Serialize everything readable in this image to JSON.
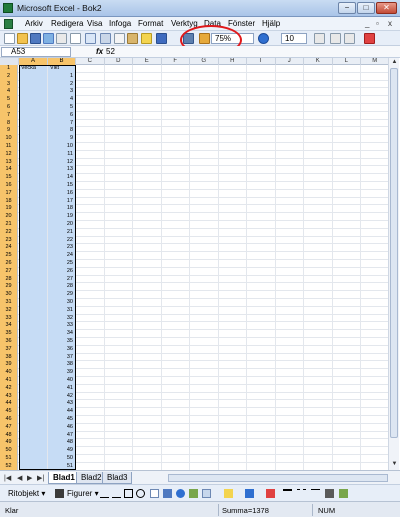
{
  "window": {
    "title": "Microsoft Excel - Bok2",
    "minimize": "−",
    "maximize": "□",
    "close": "✕"
  },
  "menu": {
    "items": [
      "Arkiv",
      "Redigera",
      "Visa",
      "Infoga",
      "Format",
      "Verktyg",
      "Data",
      "Fönster",
      "Hjälp"
    ],
    "doc_min": "_",
    "doc_restore": "▫",
    "doc_close": "x"
  },
  "toolbar": {
    "zoom": "75%",
    "font_size": "10"
  },
  "formula_bar": {
    "name_box": "A53",
    "fx": "fx",
    "value": "52"
  },
  "columns": [
    "A",
    "B",
    "C",
    "D",
    "E",
    "F",
    "G",
    "H",
    "I",
    "J",
    "K",
    "L",
    "M"
  ],
  "selected_columns": [
    "A",
    "B"
  ],
  "headers": {
    "a1": "Vecka",
    "b1": "Vikt"
  },
  "rows": [
    1,
    2,
    3,
    4,
    5,
    6,
    7,
    8,
    9,
    10,
    11,
    12,
    13,
    14,
    15,
    16,
    17,
    18,
    19,
    20,
    21,
    22,
    23,
    24,
    25,
    26,
    27,
    28,
    29,
    30,
    31,
    32,
    33,
    34,
    35,
    36,
    37,
    38,
    39,
    40,
    41,
    42,
    43,
    44,
    45,
    46,
    47,
    48,
    49,
    50,
    51,
    52,
    53
  ],
  "b_values": [
    1,
    2,
    3,
    4,
    5,
    6,
    7,
    8,
    9,
    10,
    11,
    12,
    13,
    14,
    15,
    16,
    17,
    18,
    19,
    20,
    21,
    22,
    23,
    24,
    25,
    26,
    27,
    28,
    29,
    30,
    31,
    32,
    33,
    34,
    35,
    36,
    37,
    38,
    39,
    40,
    41,
    42,
    43,
    44,
    45,
    46,
    47,
    48,
    49,
    50,
    51,
    52
  ],
  "sheets": {
    "tabs": [
      "Blad1",
      "Blad2",
      "Blad3"
    ],
    "active": "Blad1"
  },
  "drawing": {
    "ritobjekt": "Ritobjekt ▾",
    "figurer": "Figurer ▾"
  },
  "status": {
    "ready": "Klar",
    "sum": "Summa=1378",
    "num": "NUM"
  },
  "colors": {
    "header_selected": "#f7c46a",
    "cell_selected": "#c6dcf5",
    "annotation_circle": "#e0191b"
  }
}
